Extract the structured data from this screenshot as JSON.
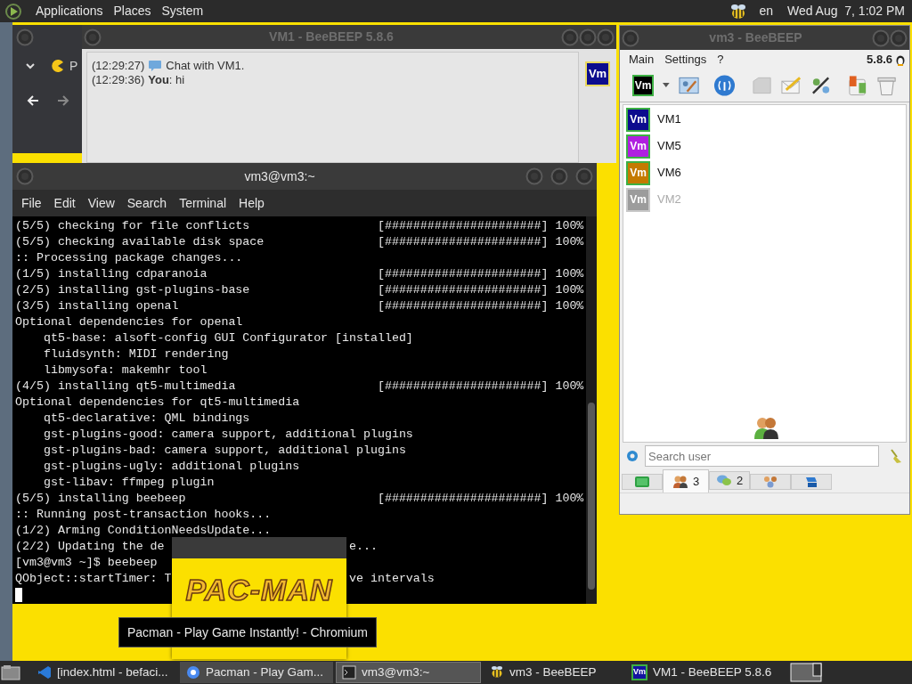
{
  "top_panel": {
    "menus": [
      "Applications",
      "Places",
      "System"
    ],
    "language": "en",
    "clock": "Wed Aug  7, 1:02 PM"
  },
  "browser_window": {
    "tab_label": "P"
  },
  "chat_window": {
    "title": "VM1 - BeeBEEP 5.8.6",
    "avatar": "Vm",
    "messages": [
      {
        "kind": "system",
        "time": "(12:29:27)",
        "text": "Chat with VM1."
      },
      {
        "kind": "user",
        "time": "(12:29:36)",
        "sender": "You",
        "text": ": hi"
      }
    ]
  },
  "terminal": {
    "title": "vm3@vm3:~",
    "menus": [
      "File",
      "Edit",
      "View",
      "Search",
      "Terminal",
      "Help"
    ],
    "cursor": true,
    "lines": [
      {
        "text": "(5/5) checking for file conflicts",
        "progress": "[######################] 100%"
      },
      {
        "text": "(5/5) checking available disk space",
        "progress": "[######################] 100%"
      },
      {
        "text": ":: Processing package changes..."
      },
      {
        "text": "(1/5) installing cdparanoia",
        "progress": "[######################] 100%"
      },
      {
        "text": "(2/5) installing gst-plugins-base",
        "progress": "[######################] 100%"
      },
      {
        "text": "(3/5) installing openal",
        "progress": "[######################] 100%"
      },
      {
        "text": "Optional dependencies for openal"
      },
      {
        "text": "    qt5-base: alsoft-config GUI Configurator [installed]"
      },
      {
        "text": "    fluidsynth: MIDI rendering"
      },
      {
        "text": "    libmysofa: makemhr tool"
      },
      {
        "text": "(4/5) installing qt5-multimedia",
        "progress": "[######################] 100%"
      },
      {
        "text": "Optional dependencies for qt5-multimedia"
      },
      {
        "text": "    qt5-declarative: QML bindings"
      },
      {
        "text": "    gst-plugins-good: camera support, additional plugins"
      },
      {
        "text": "    gst-plugins-bad: camera support, additional plugins"
      },
      {
        "text": "    gst-plugins-ugly: additional plugins"
      },
      {
        "text": "    gst-libav: ffmpeg plugin"
      },
      {
        "text": "(5/5) installing beebeep",
        "progress": "[######################] 100%"
      },
      {
        "text": ":: Running post-transaction hooks..."
      },
      {
        "text": "(1/2) Arming ConditionNeedsUpdate..."
      },
      {
        "text": "(2/2) Updating the de",
        "tail": "e..."
      },
      {
        "text": "[vm3@vm3 ~]$ beebeep"
      },
      {
        "text": "QObject::startTimer: T",
        "tail": "ve intervals"
      }
    ]
  },
  "preview": {
    "logo": "PAC-MAN",
    "tooltip": "Pacman - Play Game Instantly! - Chromium"
  },
  "beebeep": {
    "title": "vm3 - BeeBEEP",
    "menus": [
      "Main",
      "Settings",
      "?"
    ],
    "version": "5.8.6",
    "my_avatar": "Vm",
    "users": [
      {
        "avatar": "Vm",
        "name": "VM1",
        "color": "#0c0c8e",
        "online": true
      },
      {
        "avatar": "Vm",
        "name": "VM5",
        "color": "#b020e0",
        "online": true
      },
      {
        "avatar": "Vm",
        "name": "VM6",
        "color": "#c47a00",
        "online": true
      },
      {
        "avatar": "Vm",
        "name": "VM2",
        "color": "#9c9c9c",
        "online": false
      }
    ],
    "search": {
      "placeholder": "Search user"
    },
    "tabs": [
      {
        "kind": "screen",
        "selected": false
      },
      {
        "kind": "users",
        "label": "3",
        "selected": true
      },
      {
        "kind": "chats",
        "label": "2",
        "selected": false
      },
      {
        "kind": "groups",
        "selected": false
      },
      {
        "kind": "shares",
        "selected": false
      }
    ]
  },
  "taskbar": {
    "items": [
      {
        "kind": "editor",
        "label": "[index.html - befaci...",
        "selected": false,
        "hovered": false
      },
      {
        "kind": "browser",
        "label": "Pacman - Play Gam...",
        "selected": false,
        "hovered": true
      },
      {
        "kind": "terminal",
        "label": "vm3@vm3:~",
        "selected": true,
        "hovered": false
      },
      {
        "kind": "bee",
        "label": "vm3 - BeeBEEP",
        "selected": false,
        "hovered": false
      },
      {
        "kind": "vm",
        "icon_label": "Vm",
        "label": "VM1 - BeeBEEP 5.8.6",
        "selected": false,
        "hovered": false
      }
    ]
  }
}
